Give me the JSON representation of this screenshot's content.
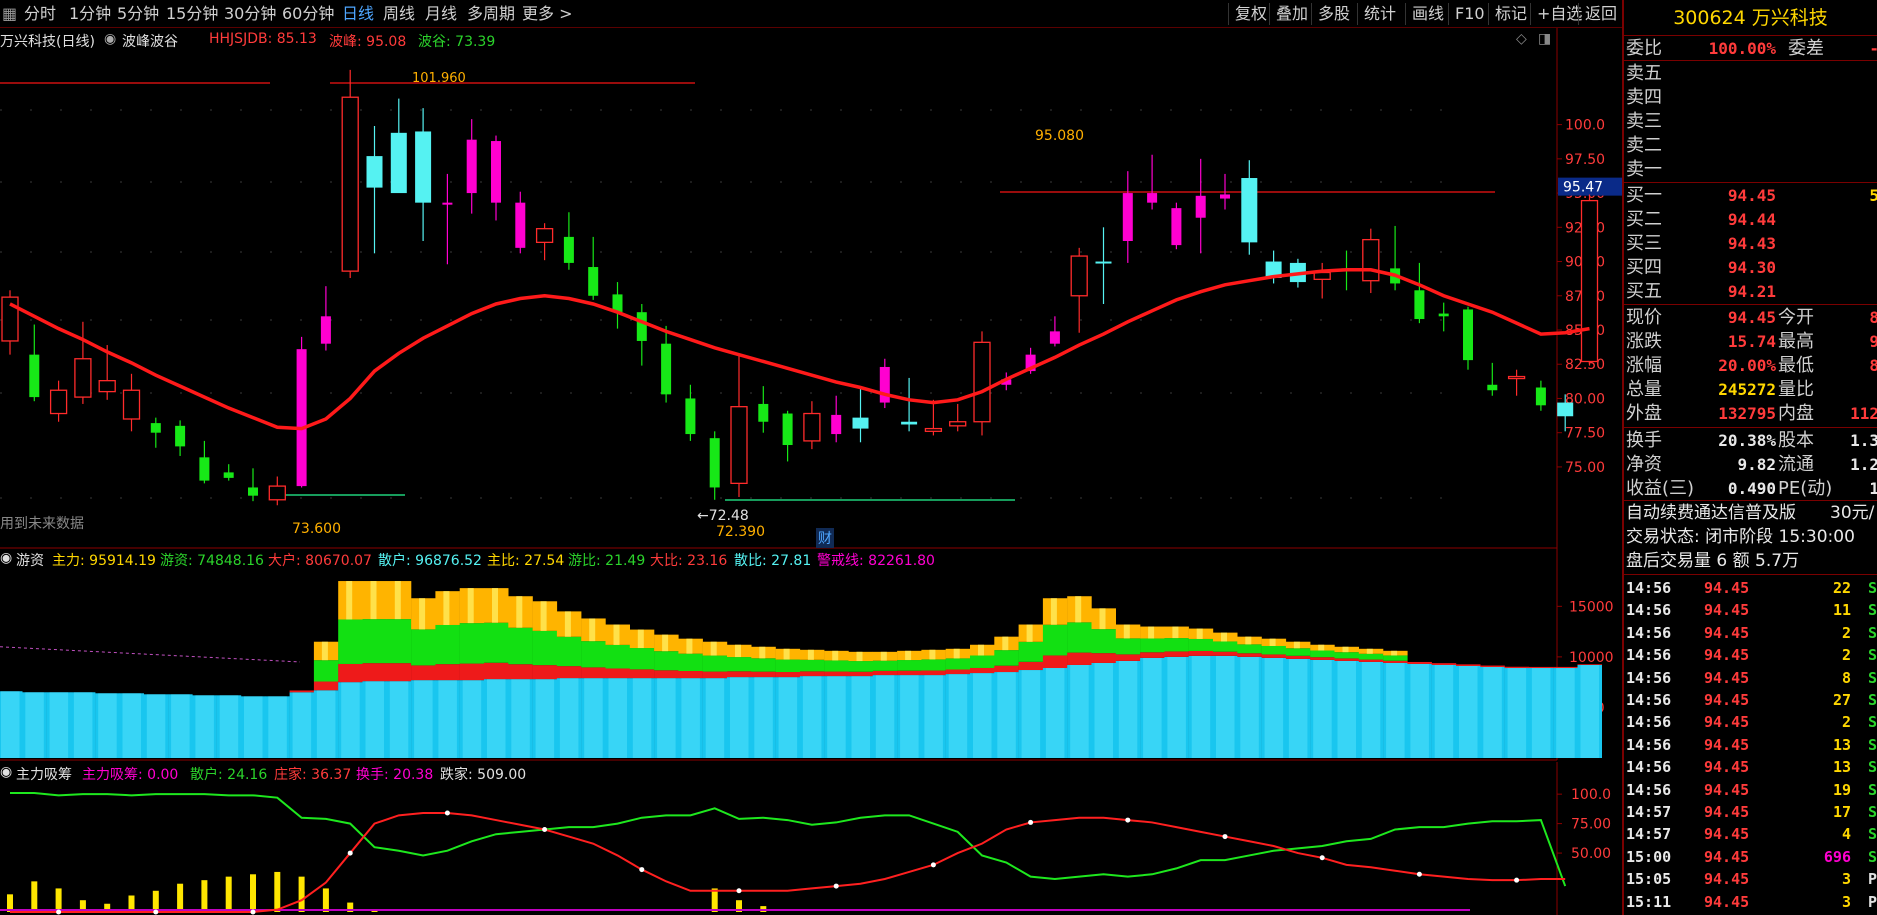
{
  "toolbar": {
    "periods": [
      "分时",
      "1分钟",
      "5分钟",
      "15分钟",
      "30分钟",
      "60分钟",
      "日线",
      "周线",
      "月线",
      "多周期",
      "更多 >"
    ],
    "active_period": "日线",
    "right_buttons": [
      "复权",
      "叠加",
      "多股",
      "统计",
      "画线",
      "F10",
      "标记",
      "+自选",
      "返回"
    ]
  },
  "kline_header": {
    "title": "万兴科技(日线)",
    "indicator_name": "波峰波谷",
    "hhjsjdb_label": "HHJSJDB: 85.13",
    "peak_label": "波峰: 95.08",
    "trough_label": "波谷: 73.39",
    "future_data_note": "用到未来数据",
    "current_price_tag": "95.47",
    "annotation_high": "101.960",
    "annotation_peak": "95.080",
    "annotation_low1": "73.600",
    "annotation_low2": "72.48",
    "annotation_low3": "72.390",
    "cai_marker": "财",
    "y_ticks": [
      "100.0",
      "97.50",
      "95.00",
      "92.50",
      "90.00",
      "87.50",
      "85.00",
      "82.50",
      "80.00",
      "77.50",
      "75.00"
    ]
  },
  "youzi_header": {
    "name": "游资",
    "zhuli": "主力: 95914.19",
    "youzi": "游资: 74848.16",
    "dahu": "大户: 80670.07",
    "sanhu": "散户: 96876.52",
    "zhubi": "主比: 27.54",
    "youbi": "游比: 21.49",
    "dabi": "大比: 23.16",
    "sanbi": "散比: 27.81",
    "jingjie": "警戒线: 82261.80",
    "y_ticks": [
      "15000",
      "10000",
      "5000"
    ],
    "scale": "X10"
  },
  "xichou_header": {
    "name": "主力吸筹",
    "xichou": "主力吸筹: 0.00",
    "sanhu": "散户: 24.16",
    "zhuangjia": "庄家: 36.37",
    "huanshou": "换手: 20.38",
    "diejia": "跌家: 509.00",
    "y_ticks": [
      "100.0",
      "75.00",
      "50.00"
    ]
  },
  "side": {
    "code_name": "300624 万兴科技",
    "weibi_label": "委比",
    "weibi_value": "100.00%",
    "weicha_label": "委差",
    "sells": [
      {
        "label": "卖五"
      },
      {
        "label": "卖四"
      },
      {
        "label": "卖三"
      },
      {
        "label": "卖二"
      },
      {
        "label": "卖一"
      }
    ],
    "buys": [
      {
        "label": "买一",
        "price": "94.45",
        "vol": "5"
      },
      {
        "label": "买二",
        "price": "94.44"
      },
      {
        "label": "买三",
        "price": "94.43"
      },
      {
        "label": "买四",
        "price": "94.30"
      },
      {
        "label": "买五",
        "price": "94.21"
      }
    ],
    "quote": [
      {
        "l1": "现价",
        "v1": "94.45",
        "l2": "今开",
        "v2": "8"
      },
      {
        "l1": "涨跌",
        "v1": "15.74",
        "l2": "最高",
        "v2": "9"
      },
      {
        "l1": "涨幅",
        "v1": "20.00%",
        "l2": "最低",
        "v2": "8"
      },
      {
        "l1": "总量",
        "v1": "245272",
        "l2": "量比",
        "v2": ""
      },
      {
        "l1": "外盘",
        "v1": "132795",
        "l2": "内盘",
        "v2": "112"
      }
    ],
    "stats": [
      {
        "l1": "换手",
        "v1": "20.38%",
        "l2": "股本",
        "v2": "1.3"
      },
      {
        "l1": "净资",
        "v1": "9.82",
        "l2": "流通",
        "v2": "1.2"
      },
      {
        "l1": "收益(三)",
        "v1": "0.490",
        "l2": "PE(动)",
        "v2": "1"
      }
    ],
    "promo": "自动续费通达信普及版",
    "promo_price": "30元/",
    "trade_status": "交易状态: 闭市阶段 15:30:00",
    "after_hours": "盘后交易量 6 额 5.7万",
    "ticks": [
      {
        "t": "14:56",
        "p": "94.45",
        "v": "22",
        "f": "S"
      },
      {
        "t": "14:56",
        "p": "94.45",
        "v": "11",
        "f": "S"
      },
      {
        "t": "14:56",
        "p": "94.45",
        "v": "2",
        "f": "S"
      },
      {
        "t": "14:56",
        "p": "94.45",
        "v": "2",
        "f": "S"
      },
      {
        "t": "14:56",
        "p": "94.45",
        "v": "8",
        "f": "S"
      },
      {
        "t": "14:56",
        "p": "94.45",
        "v": "27",
        "f": "S"
      },
      {
        "t": "14:56",
        "p": "94.45",
        "v": "2",
        "f": "S"
      },
      {
        "t": "14:56",
        "p": "94.45",
        "v": "13",
        "f": "S"
      },
      {
        "t": "14:56",
        "p": "94.45",
        "v": "13",
        "f": "S"
      },
      {
        "t": "14:56",
        "p": "94.45",
        "v": "19",
        "f": "S"
      },
      {
        "t": "14:57",
        "p": "94.45",
        "v": "17",
        "f": "S"
      },
      {
        "t": "14:57",
        "p": "94.45",
        "v": "4",
        "f": "S"
      },
      {
        "t": "15:00",
        "p": "94.45",
        "v": "696",
        "f": "S"
      },
      {
        "t": "15:05",
        "p": "94.45",
        "v": "3",
        "f": "P"
      },
      {
        "t": "15:11",
        "p": "94.45",
        "v": "3",
        "f": "P"
      }
    ]
  },
  "chart_data": {
    "type": "candlestick",
    "price_ylim": [
      72.0,
      104.5
    ],
    "candles": [
      {
        "o": 84.2,
        "c": 87.4,
        "h": 87.9,
        "l": 83.2
      },
      {
        "o": 83.2,
        "c": 80.1,
        "h": 85.4,
        "l": 79.8
      },
      {
        "o": 78.9,
        "c": 80.6,
        "h": 81.3,
        "l": 78.3
      },
      {
        "o": 80.1,
        "c": 82.9,
        "h": 85.6,
        "l": 79.6
      },
      {
        "o": 80.5,
        "c": 81.3,
        "h": 83.9,
        "l": 79.9
      },
      {
        "o": 78.5,
        "c": 80.6,
        "h": 81.8,
        "l": 77.6
      },
      {
        "o": 78.2,
        "c": 77.5,
        "h": 78.6,
        "l": 76.4
      },
      {
        "o": 78.0,
        "c": 76.5,
        "h": 78.4,
        "l": 75.8
      },
      {
        "o": 75.7,
        "c": 74.0,
        "h": 76.9,
        "l": 73.8
      },
      {
        "o": 74.6,
        "c": 74.2,
        "h": 75.2,
        "l": 74.0
      },
      {
        "o": 73.5,
        "c": 72.9,
        "h": 74.9,
        "l": 72.5
      },
      {
        "o": 72.6,
        "c": 73.6,
        "h": 74.3,
        "l": 72.2
      },
      {
        "o": 73.6,
        "c": 83.6,
        "h": 84.5,
        "l": 73.5
      },
      {
        "o": 84.0,
        "c": 86.0,
        "h": 88.2,
        "l": 83.5
      },
      {
        "o": 89.3,
        "c": 102.0,
        "h": 104.0,
        "l": 88.8
      },
      {
        "o": 97.7,
        "c": 95.4,
        "h": 99.9,
        "l": 90.6
      },
      {
        "o": 99.4,
        "c": 95.0,
        "h": 101.9,
        "l": 96.5
      },
      {
        "o": 99.5,
        "c": 94.3,
        "h": 101.2,
        "l": 91.5
      },
      {
        "o": 94.3,
        "c": 94.2,
        "h": 96.4,
        "l": 89.8
      },
      {
        "o": 95.0,
        "c": 98.9,
        "h": 100.4,
        "l": 93.5
      },
      {
        "o": 98.8,
        "c": 94.3,
        "h": 99.2,
        "l": 93.0
      },
      {
        "o": 94.3,
        "c": 91.0,
        "h": 95.1,
        "l": 90.6
      },
      {
        "o": 91.4,
        "c": 92.4,
        "h": 92.8,
        "l": 90.1
      },
      {
        "o": 91.8,
        "c": 89.9,
        "h": 93.6,
        "l": 89.4
      },
      {
        "o": 89.6,
        "c": 87.5,
        "h": 91.8,
        "l": 87.2
      },
      {
        "o": 87.6,
        "c": 86.3,
        "h": 88.5,
        "l": 85.1
      },
      {
        "o": 86.3,
        "c": 84.2,
        "h": 86.9,
        "l": 82.4
      },
      {
        "o": 84.0,
        "c": 80.3,
        "h": 85.3,
        "l": 79.7
      },
      {
        "o": 80.0,
        "c": 77.4,
        "h": 81.0,
        "l": 76.9
      },
      {
        "o": 77.1,
        "c": 73.5,
        "h": 77.6,
        "l": 72.6
      },
      {
        "o": 73.8,
        "c": 79.4,
        "h": 83.1,
        "l": 72.8
      },
      {
        "o": 79.6,
        "c": 78.3,
        "h": 80.9,
        "l": 77.5
      },
      {
        "o": 78.9,
        "c": 76.6,
        "h": 79.1,
        "l": 75.4
      },
      {
        "o": 76.9,
        "c": 78.9,
        "h": 79.8,
        "l": 76.3
      },
      {
        "o": 77.4,
        "c": 78.8,
        "h": 80.2,
        "l": 76.8
      },
      {
        "o": 78.6,
        "c": 77.8,
        "h": 80.9,
        "l": 76.8
      },
      {
        "o": 79.7,
        "c": 82.3,
        "h": 82.9,
        "l": 79.3
      },
      {
        "o": 78.3,
        "c": 78.1,
        "h": 81.5,
        "l": 77.6
      },
      {
        "o": 77.6,
        "c": 77.8,
        "h": 79.9,
        "l": 77.3
      },
      {
        "o": 78.0,
        "c": 78.3,
        "h": 79.6,
        "l": 77.6
      },
      {
        "o": 78.3,
        "c": 84.1,
        "h": 84.9,
        "l": 77.3
      },
      {
        "o": 81.0,
        "c": 81.4,
        "h": 81.9,
        "l": 80.6
      },
      {
        "o": 82.0,
        "c": 83.2,
        "h": 83.7,
        "l": 81.8
      },
      {
        "o": 84.0,
        "c": 84.9,
        "h": 86.0,
        "l": 83.8
      },
      {
        "o": 87.5,
        "c": 90.4,
        "h": 91.0,
        "l": 84.8
      },
      {
        "o": 90.0,
        "c": 89.9,
        "h": 92.5,
        "l": 86.9
      },
      {
        "o": 91.5,
        "c": 95.0,
        "h": 96.6,
        "l": 89.9
      },
      {
        "o": 95.0,
        "c": 94.3,
        "h": 97.8,
        "l": 93.8
      },
      {
        "o": 93.9,
        "c": 91.2,
        "h": 94.3,
        "l": 90.9
      },
      {
        "o": 93.2,
        "c": 94.8,
        "h": 97.5,
        "l": 90.6
      },
      {
        "o": 94.9,
        "c": 94.6,
        "h": 96.4,
        "l": 93.8
      },
      {
        "o": 96.1,
        "c": 91.4,
        "h": 97.4,
        "l": 90.5
      },
      {
        "o": 90.0,
        "c": 88.8,
        "h": 90.8,
        "l": 88.4
      },
      {
        "o": 89.9,
        "c": 88.5,
        "h": 90.2,
        "l": 88.1
      },
      {
        "o": 88.7,
        "c": 89.2,
        "h": 89.9,
        "l": 87.3
      },
      {
        "o": 89.5,
        "c": 89.3,
        "h": 90.8,
        "l": 87.9
      },
      {
        "o": 88.6,
        "c": 91.6,
        "h": 92.4,
        "l": 87.7
      },
      {
        "o": 89.5,
        "c": 88.4,
        "h": 92.6,
        "l": 87.9
      },
      {
        "o": 87.9,
        "c": 85.8,
        "h": 89.9,
        "l": 85.5
      },
      {
        "o": 86.2,
        "c": 86.0,
        "h": 87.0,
        "l": 84.9
      },
      {
        "o": 86.5,
        "c": 82.8,
        "h": 86.7,
        "l": 82.1
      },
      {
        "o": 81.0,
        "c": 80.6,
        "h": 82.6,
        "l": 80.2
      },
      {
        "o": 81.5,
        "c": 81.6,
        "h": 82.1,
        "l": 80.2
      },
      {
        "o": 80.8,
        "c": 79.5,
        "h": 81.3,
        "l": 79.1
      },
      {
        "o": 79.7,
        "c": 78.7,
        "h": 80.3,
        "l": 77.6
      },
      {
        "o": 82.7,
        "c": 94.45,
        "h": 94.9,
        "l": 82.4
      }
    ],
    "ma_line": [
      86.9,
      86.0,
      85.1,
      84.3,
      83.4,
      82.6,
      81.7,
      80.9,
      80.1,
      79.3,
      78.6,
      77.9,
      77.8,
      78.5,
      80.0,
      82.0,
      83.3,
      84.4,
      85.3,
      86.2,
      86.9,
      87.3,
      87.5,
      87.3,
      86.9,
      86.3,
      85.6,
      84.9,
      84.3,
      83.7,
      83.2,
      82.7,
      82.2,
      81.7,
      81.2,
      80.8,
      80.3,
      79.9,
      79.7,
      79.9,
      80.5,
      81.4,
      82.2,
      83.0,
      83.9,
      84.7,
      85.6,
      86.4,
      87.2,
      87.8,
      88.3,
      88.6,
      88.9,
      89.1,
      89.3,
      89.4,
      89.4,
      89.0,
      88.3,
      87.5,
      86.9,
      86.3,
      85.5,
      84.7,
      84.8,
      85.1
    ],
    "youzi_ylim": [
      0,
      18000
    ],
    "youzi_base": [
      6600,
      6500,
      6500,
      6500,
      6400,
      6400,
      6300,
      6300,
      6200,
      6200,
      6100,
      6100,
      6500,
      6700,
      7500,
      7600,
      7600,
      7700,
      7700,
      7700,
      7800,
      7800,
      7800,
      7900,
      7900,
      7900,
      7900,
      7900,
      7900,
      7900,
      8000,
      8000,
      8000,
      8100,
      8100,
      8100,
      8200,
      8200,
      8200,
      8300,
      8400,
      8500,
      8700,
      8900,
      9200,
      9400,
      9600,
      9900,
      10000,
      10100,
      10100,
      10000,
      9900,
      9800,
      9700,
      9600,
      9500,
      9400,
      9300,
      9200,
      9100,
      9000,
      8900,
      8900,
      8900,
      9200
    ],
    "youzi_top": [
      6700,
      6600,
      6600,
      6600,
      6500,
      6500,
      6400,
      6400,
      6300,
      6300,
      6200,
      6200,
      7500,
      11500,
      17500,
      17500,
      17500,
      15800,
      16500,
      16800,
      16800,
      16000,
      15500,
      14500,
      13800,
      13200,
      12700,
      12200,
      11800,
      11500,
      11200,
      11000,
      10800,
      10700,
      10600,
      10500,
      10500,
      10600,
      10700,
      10800,
      11200,
      12000,
      13200,
      15800,
      16000,
      14800,
      13200,
      13000,
      13000,
      12800,
      12400,
      12000,
      11800,
      11500,
      11200,
      11000,
      10800,
      10600,
      10400,
      10200,
      10000,
      9800,
      9600,
      9500,
      9500,
      9600
    ],
    "xichou_ylim": [
      0,
      112
    ],
    "xichou_green": [
      101,
      101,
      99,
      100,
      100,
      99,
      100,
      100,
      100,
      99,
      99,
      97,
      80,
      79,
      75,
      55,
      52,
      48,
      52,
      60,
      66,
      68,
      70,
      72,
      72,
      75,
      80,
      82,
      82,
      88,
      79,
      80,
      78,
      74,
      76,
      80,
      82,
      82,
      75,
      68,
      48,
      42,
      30,
      28,
      30,
      32,
      30,
      32,
      37,
      44,
      44,
      48,
      52,
      54,
      56,
      60,
      62,
      70,
      72,
      72,
      75,
      77,
      77,
      78,
      22
    ],
    "xichou_red": [
      0,
      0,
      0,
      0,
      0,
      0,
      0,
      0,
      0,
      0,
      0,
      2,
      10,
      25,
      50,
      75,
      82,
      84,
      84,
      82,
      78,
      74,
      70,
      64,
      58,
      48,
      36,
      26,
      18,
      18,
      18,
      18,
      18,
      20,
      22,
      24,
      28,
      34,
      40,
      50,
      58,
      70,
      76,
      78,
      80,
      80,
      78,
      76,
      72,
      68,
      64,
      60,
      56,
      50,
      46,
      40,
      38,
      35,
      32,
      30,
      28,
      27,
      27,
      28,
      28
    ],
    "xichou_bars": [
      15,
      26,
      20,
      10,
      7,
      14,
      18,
      24,
      27,
      30,
      32,
      34,
      30,
      20,
      8,
      2,
      0,
      0,
      0,
      0,
      0,
      0,
      0,
      0,
      0,
      0,
      0,
      0,
      0,
      20,
      10,
      5,
      0,
      0,
      0,
      0,
      0,
      0,
      0,
      0,
      0,
      0,
      0,
      0,
      0,
      0,
      0,
      0,
      0,
      0,
      0,
      0,
      0,
      0,
      0,
      0,
      0,
      0,
      0,
      0,
      0,
      0,
      0,
      0,
      0
    ]
  },
  "colors": {
    "up": "#ff2b2b",
    "down_fill": "#55f2f2",
    "down_green": "#17e817",
    "magenta": "#ff00d0",
    "ma": "#ff1a1a",
    "axis_red": "#8c0000"
  }
}
